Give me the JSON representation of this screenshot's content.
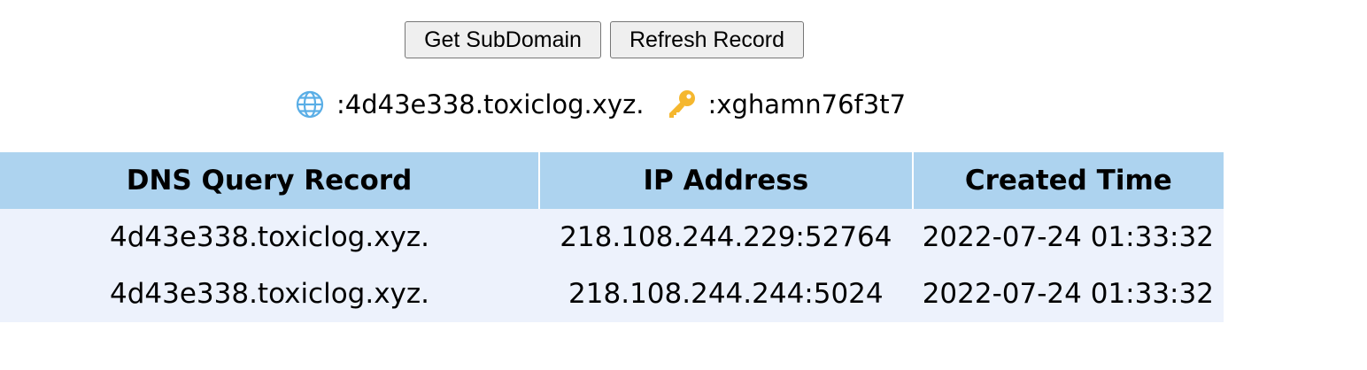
{
  "toolbar": {
    "get_subdomain_label": "Get SubDomain",
    "refresh_record_label": "Refresh Record"
  },
  "info": {
    "domain_icon": "globe-icon",
    "domain_text": ":4d43e338.toxiclog.xyz.",
    "token_icon": "key-icon",
    "token_text": ":xghamn76f3t7"
  },
  "table": {
    "headers": [
      "DNS Query Record",
      "IP Address",
      "Created Time"
    ],
    "rows": [
      [
        "4d43e338.toxiclog.xyz.",
        "218.108.244.229:52764",
        "2022-07-24 01:33:32"
      ],
      [
        "4d43e338.toxiclog.xyz.",
        "218.108.244.244:5024",
        "2022-07-24 01:33:32"
      ]
    ]
  },
  "colors": {
    "header_bg": "#add3ef",
    "row_bg": "#edf2fc",
    "button_bg": "#efefef",
    "globe_color": "#5aaee6",
    "key_color": "#f5b72e"
  }
}
